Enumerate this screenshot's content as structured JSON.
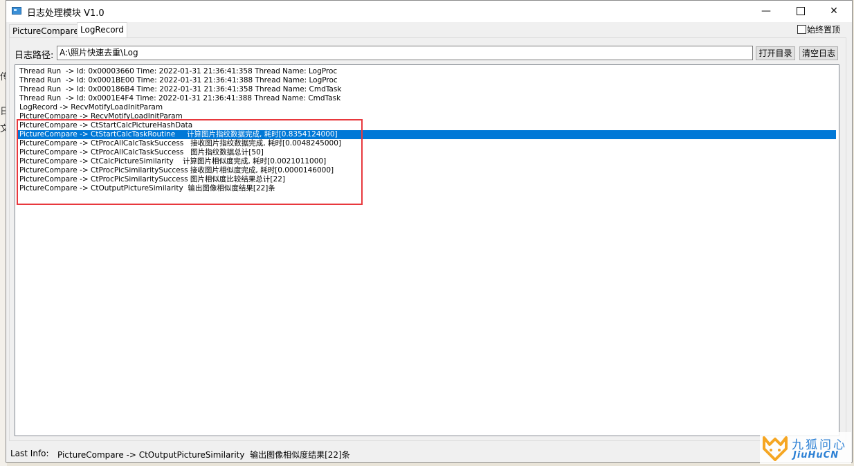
{
  "window": {
    "title": "日志处理模块 V1.0",
    "minimize_glyph": "—",
    "close_glyph": "✕"
  },
  "tabs": [
    {
      "label": "PictureCompare",
      "active": false
    },
    {
      "label": "LogRecord",
      "active": true
    }
  ],
  "always_on_top": {
    "label": "始终置顶",
    "checked": false
  },
  "log_path": {
    "label": "日志路径:",
    "value": "A:\\照片快速去重\\Log"
  },
  "buttons": {
    "open_dir": "打开目录",
    "clear_log": "清空日志"
  },
  "log_lines": [
    {
      "text": "Thread Run  -> Id: 0x00003660 Time: 2022-01-31 21:36:41:358 Thread Name: LogProc",
      "selected": false
    },
    {
      "text": "Thread Run  -> Id: 0x0001BE00 Time: 2022-01-31 21:36:41:388 Thread Name: LogProc",
      "selected": false
    },
    {
      "text": "Thread Run  -> Id: 0x000186B4 Time: 2022-01-31 21:36:41:358 Thread Name: CmdTask",
      "selected": false
    },
    {
      "text": "Thread Run  -> Id: 0x0001E4F4 Time: 2022-01-31 21:36:41:388 Thread Name: CmdTask",
      "selected": false
    },
    {
      "text": "LogRecord -> RecvMotifyLoadInitParam",
      "selected": false
    },
    {
      "text": "PictureCompare -> RecvMotifyLoadInitParam",
      "selected": false
    },
    {
      "text": "PictureCompare -> CtStartCalcPictureHashData",
      "selected": false
    },
    {
      "text": "PictureCompare -> CtStartCalcTaskRoutine     计算图片指纹数据完成, 耗时[0.8354124000]",
      "selected": true
    },
    {
      "text": "PictureCompare -> CtProcAllCalcTaskSuccess   接收图片指纹数据完成, 耗时[0.0048245000]",
      "selected": false
    },
    {
      "text": "PictureCompare -> CtProcAllCalcTaskSuccess   图片指纹数据总计[50]",
      "selected": false
    },
    {
      "text": "PictureCompare -> CtCalcPictureSimilarity    计算图片相似度完成, 耗时[0.0021011000]",
      "selected": false
    },
    {
      "text": "PictureCompare -> CtProcPicSimilaritySuccess 接收图片相似度完成, 耗时[0.0000146000]",
      "selected": false
    },
    {
      "text": "PictureCompare -> CtProcPicSimilaritySuccess 图片相似度比较结果总计[22]",
      "selected": false
    },
    {
      "text": "PictureCompare -> CtOutputPictureSimilarity  输出图像相似度结果[22]条",
      "selected": false
    }
  ],
  "status_bar": {
    "label": "Last Info:",
    "value": "PictureCompare -> CtOutputPictureSimilarity  输出图像相似度结果[22]条"
  },
  "watermark": {
    "cn": "九狐问心",
    "en": "JiuHuCN",
    "color": "#2a7fd4",
    "fox_color": "#f5a623"
  },
  "background_fragments": [
    "日",
    "文",
    "传"
  ],
  "colors": {
    "selection": "#0078d7",
    "highlight_box": "#e8383d"
  }
}
